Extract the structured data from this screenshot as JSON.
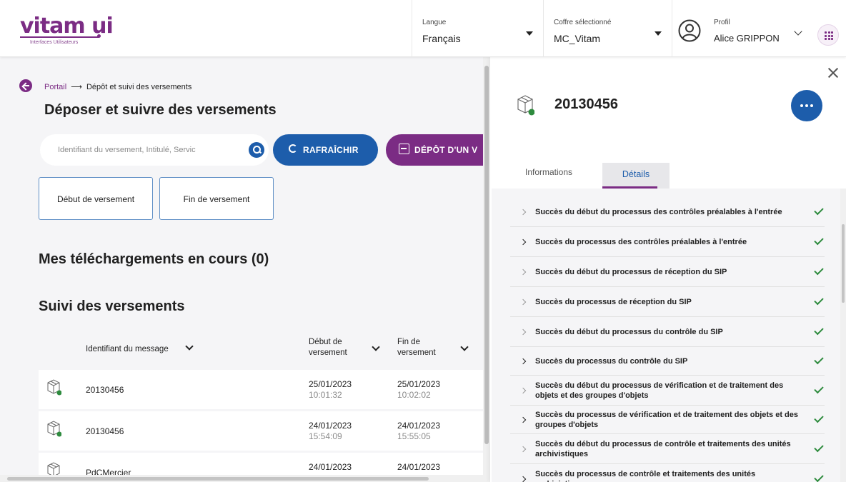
{
  "header": {
    "logo_text": "vitam ui",
    "logo_subtitle": "Interfaces Utilisateurs",
    "language": {
      "label": "Langue",
      "value": "Français"
    },
    "vault": {
      "label": "Coffre sélectionné",
      "value": "MC_Vitam"
    },
    "profile": {
      "label": "Profil",
      "value": "Alice GRIPPON"
    }
  },
  "breadcrumb": {
    "portal": "Portail",
    "arrow": "⟶",
    "current": "Dépôt et suivi des versements"
  },
  "page_title": "Déposer et suivre des versements",
  "search": {
    "placeholder": "Identifiant du versement, Intitulé, Servic",
    "value": ""
  },
  "buttons": {
    "refresh": "RAFRAÎCHIR",
    "deposit": "DÉPÔT D'UN V"
  },
  "filters": [
    "Début de versement",
    "Fin de versement"
  ],
  "downloads_title": "Mes téléchargements en cours (0)",
  "tracking_title": "Suivi des versements",
  "table": {
    "columns": {
      "id": "Identifiant du message",
      "start_line1": "Début de",
      "start_line2": "versement",
      "end_line1": "Fin de",
      "end_line2": "versement"
    },
    "rows": [
      {
        "id": "20130456",
        "start_date": "25/01/2023",
        "start_time": "10:01:32",
        "end_date": "25/01/2023",
        "end_time": "10:02:02",
        "status_color": "#2e8b3e"
      },
      {
        "id": "20130456",
        "start_date": "24/01/2023",
        "start_time": "15:54:09",
        "end_date": "24/01/2023",
        "end_time": "15:55:05",
        "status_color": "#2e8b3e"
      },
      {
        "id": "PdCMercier",
        "start_date": "24/01/2023",
        "start_time": "",
        "end_date": "24/01/2023",
        "end_time": "",
        "status_color": ""
      }
    ]
  },
  "detail": {
    "title": "20130456",
    "status_color": "#2e8b3e",
    "tabs": {
      "info": "Informations",
      "details": "Détails"
    },
    "steps": [
      {
        "text": "Succès du début du processus des contrôles préalables à l'entrée",
        "expandable": false
      },
      {
        "text": "Succès du processus des contrôles préalables à l'entrée",
        "expandable": true
      },
      {
        "text": "Succès du début du processus de réception du SIP",
        "expandable": false
      },
      {
        "text": "Succès du processus de réception du SIP",
        "expandable": false
      },
      {
        "text": "Succès du début du processus du contrôle du SIP",
        "expandable": false
      },
      {
        "text": "Succès du processus du contrôle du SIP",
        "expandable": true
      },
      {
        "text": "Succès du début du processus de vérification et de traitement des objets et des groupes d'objets",
        "expandable": false
      },
      {
        "text": "Succès du processus de vérification et de traitement des objets et des groupes d'objets",
        "expandable": true
      },
      {
        "text": "Succès du début du processus de contrôle et traitements des unités archivistiques",
        "expandable": false
      },
      {
        "text": "Succès du processus de contrôle et traitements des unités archivistiques",
        "expandable": true
      }
    ]
  },
  "colors": {
    "primary_purple": "#7b2c84",
    "primary_blue": "#1d5dab",
    "success_green": "#2e8b3e"
  }
}
